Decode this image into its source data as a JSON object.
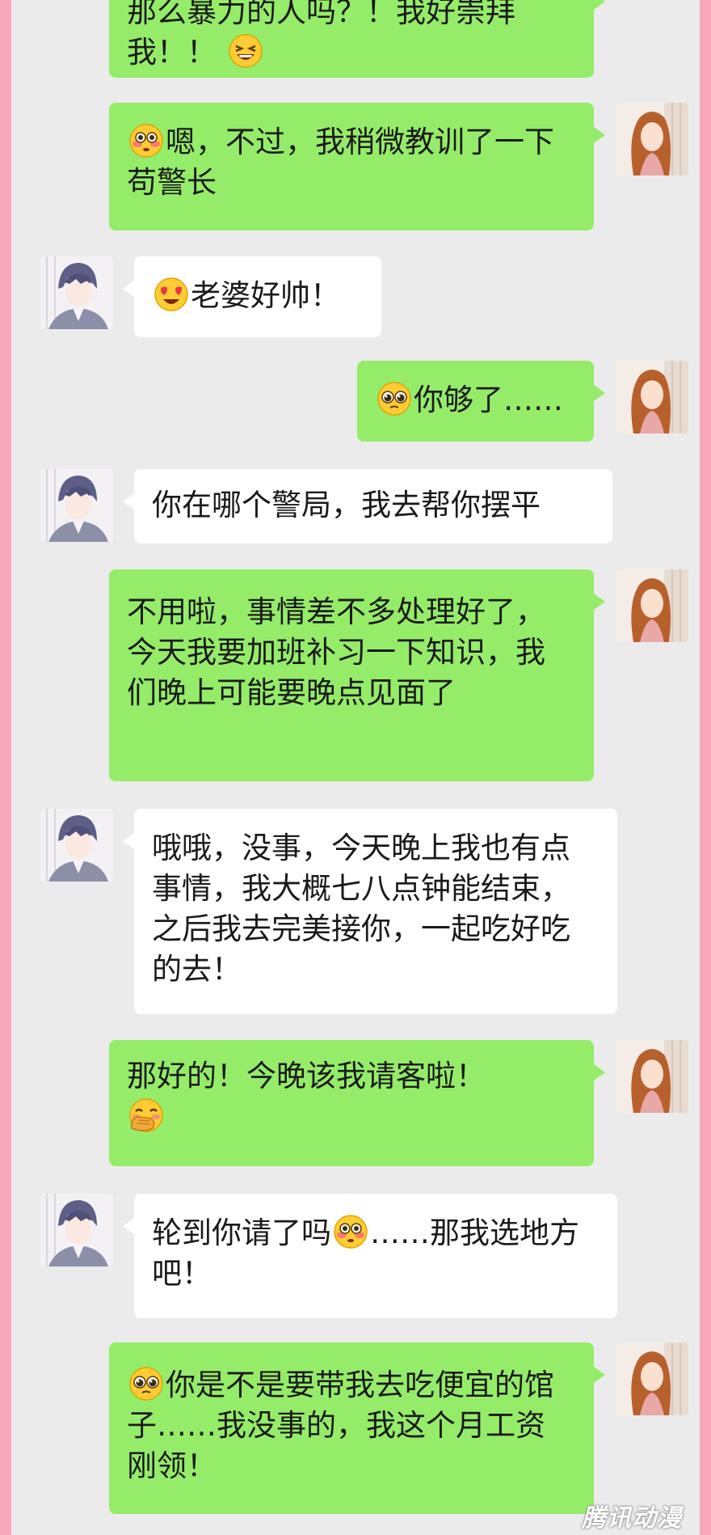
{
  "messages": [
    {
      "sender": "her",
      "text_before": "那么暴力的人吗？！我好崇拜",
      "text_line2": "我！！",
      "emoji": "laughing-tears"
    },
    {
      "sender": "her",
      "emoji": "flushed",
      "text": "嗯，不过，我稍微教训了一下苟警长"
    },
    {
      "sender": "him",
      "emoji": "heart-eyes",
      "text": "老婆好帅！"
    },
    {
      "sender": "her",
      "emoji": "pleading",
      "text": "你够了……"
    },
    {
      "sender": "him",
      "text": "你在哪个警局，我去帮你摆平"
    },
    {
      "sender": "her",
      "text": "不用啦，事情差不多处理好了，今天我要加班补习一下知识，我们晚上可能要晚点见面了"
    },
    {
      "sender": "him",
      "text": "哦哦，没事，今天晚上我也有点事情，我大概七八点钟能结束，之后我去完美接你，一起吃好吃的去！"
    },
    {
      "sender": "her",
      "text": "那好的！今晚该我请客啦！",
      "emoji": "hand-over-mouth"
    },
    {
      "sender": "him",
      "text_before": "轮到你请了吗",
      "emoji": "flushed",
      "text_after": "……那我选地方吧！"
    },
    {
      "sender": "her",
      "emoji": "pleading",
      "text": "你是不是要带我去吃便宜的馆子……我没事的，我这个月工资刚领！"
    }
  ],
  "watermark": "腾讯动漫",
  "colors": {
    "my_bubble": "#95ec69",
    "their_bubble": "#ffffff",
    "chat_background": "#ebebeb",
    "frame": "#f7a7b8"
  }
}
